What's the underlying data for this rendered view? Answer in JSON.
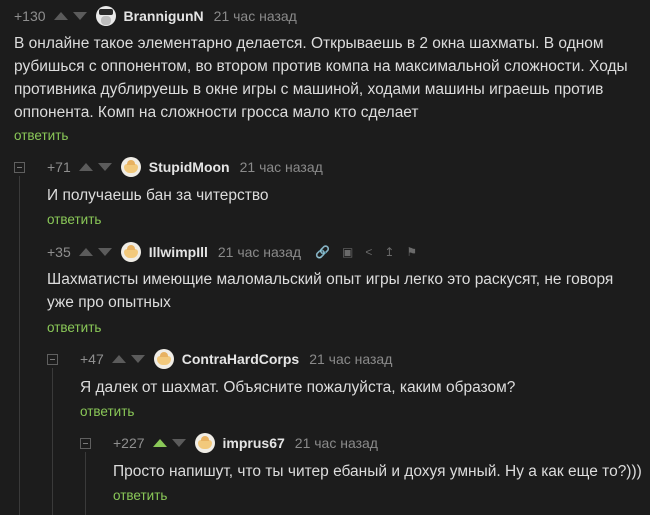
{
  "comments": [
    {
      "rating": "+130",
      "username": "BrannigunN",
      "time": "21 час назад",
      "text": "В онлайне такое элементарно делается. Открываешь в 2 окна шахматы. В одном рубишься с оппонентом, во втором против компа на максимальной сложности. Ходы противника дублируешь в окне игры с машиной, ходами машины играешь против оппонента. Комп на сложности гросса мало кто сделает",
      "reply": "ответить",
      "avatar": "hat-avatar"
    },
    {
      "rating": "+71",
      "username": "StupidMoon",
      "time": "21 час назад",
      "text": "И получаешь бан за читерство",
      "reply": "ответить",
      "avatar": "peach-avatar"
    },
    {
      "rating": "+35",
      "username": "IllwimpIll",
      "time": "21 час назад",
      "text": "Шахматисты имеющие маломальский опыт игры легко это раскусят, не говоря уже про опытных",
      "reply": "ответить",
      "avatar": "peach-avatar"
    },
    {
      "rating": "+47",
      "username": "ContraHardCorps",
      "time": "21 час назад",
      "text": "Я далек от шахмат. Объясните пожалуйста, каким образом?",
      "reply": "ответить",
      "avatar": "peach-avatar"
    },
    {
      "rating": "+227",
      "username": "imprus67",
      "time": "21 час назад",
      "text": "Просто напишут, что ты читер ебаный и дохуя умный. Ну а как еще то?)))",
      "reply": "ответить",
      "avatar": "peach-avatar"
    }
  ],
  "colors": {
    "background": "#1c1c1c",
    "accent": "#8ac858",
    "text": "#dcdcdc"
  }
}
